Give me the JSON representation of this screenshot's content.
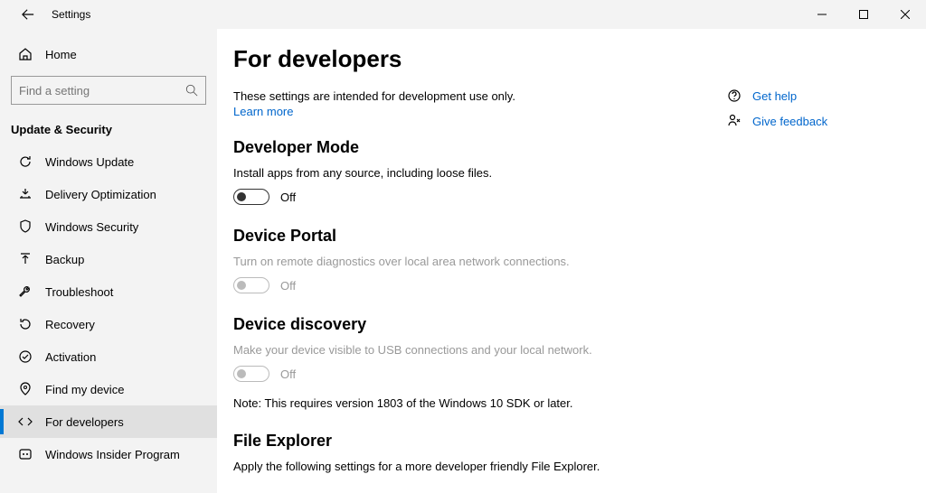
{
  "titlebar": {
    "title": "Settings"
  },
  "sidebar": {
    "home": "Home",
    "search_placeholder": "Find a setting",
    "group": "Update & Security",
    "items": [
      {
        "label": "Windows Update"
      },
      {
        "label": "Delivery Optimization"
      },
      {
        "label": "Windows Security"
      },
      {
        "label": "Backup"
      },
      {
        "label": "Troubleshoot"
      },
      {
        "label": "Recovery"
      },
      {
        "label": "Activation"
      },
      {
        "label": "Find my device"
      },
      {
        "label": "For developers"
      },
      {
        "label": "Windows Insider Program"
      }
    ]
  },
  "main": {
    "title": "For developers",
    "intro": "These settings are intended for development use only.",
    "learn_more": "Learn more",
    "devmode": {
      "title": "Developer Mode",
      "desc": "Install apps from any source, including loose files.",
      "state": "Off"
    },
    "portal": {
      "title": "Device Portal",
      "desc": "Turn on remote diagnostics over local area network connections.",
      "state": "Off"
    },
    "discovery": {
      "title": "Device discovery",
      "desc": "Make your device visible to USB connections and your local network.",
      "state": "Off",
      "note": "Note: This requires version 1803 of the Windows 10 SDK or later."
    },
    "explorer": {
      "title": "File Explorer",
      "desc": "Apply the following settings for a more developer friendly File Explorer."
    }
  },
  "help": {
    "get_help": "Get help",
    "give_feedback": "Give feedback"
  }
}
